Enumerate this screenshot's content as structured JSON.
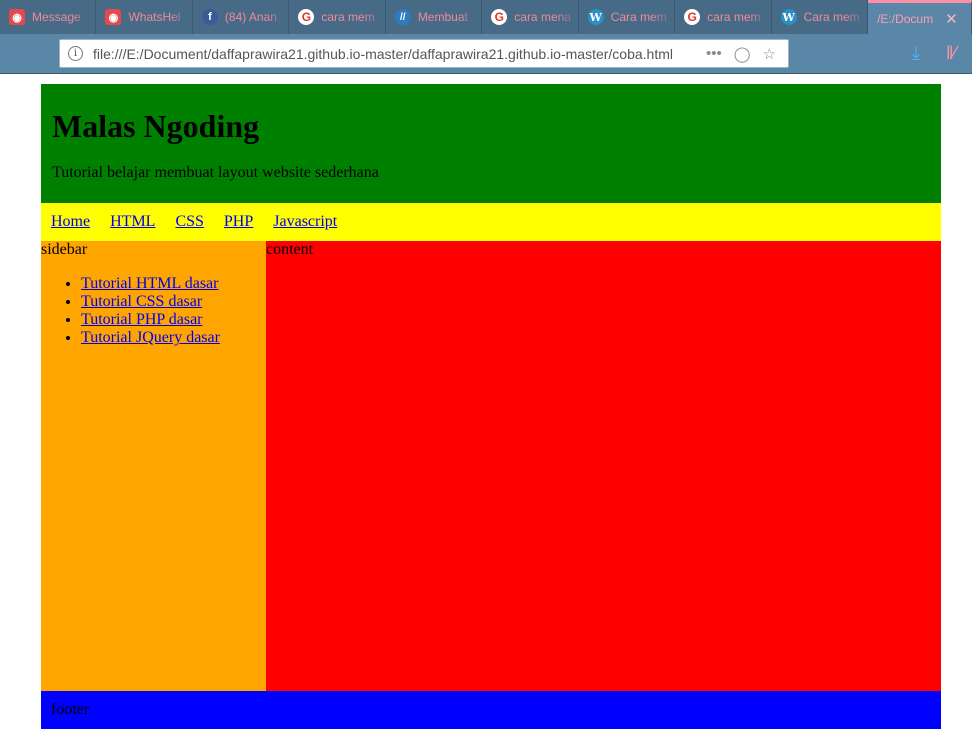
{
  "browser": {
    "tabs": [
      {
        "title": "Message",
        "icon": "red-chat-icon"
      },
      {
        "title": "WhatsHel",
        "icon": "red-chat-icon"
      },
      {
        "title": "(84) Anan",
        "icon": "facebook-icon"
      },
      {
        "title": "cara mem",
        "icon": "google-icon"
      },
      {
        "title": "Membuat",
        "icon": "code-icon"
      },
      {
        "title": "cara mena",
        "icon": "google-icon"
      },
      {
        "title": "Cara mem",
        "icon": "wordpress-icon"
      },
      {
        "title": "cara mem",
        "icon": "google-icon"
      },
      {
        "title": "Cara mem",
        "icon": "wordpress-icon"
      },
      {
        "title": "/E:/Docum",
        "icon": "none"
      }
    ],
    "url": "file:///E:/Document/daffaprawira21.github.io-master/daffaprawira21.github.io-master/coba.html"
  },
  "page": {
    "header": {
      "title": "Malas Ngoding",
      "tagline": "Tutorial belajar membuat layout website sederhana"
    },
    "menu": [
      "Home",
      "HTML",
      "CSS",
      "PHP",
      "Javascript"
    ],
    "sidebar": {
      "label": "sidebar",
      "links": [
        "Tutorial HTML dasar",
        "Tutorial CSS dasar",
        "Tutorial PHP dasar",
        "Tutorial JQuery dasar"
      ]
    },
    "content": {
      "label": "content"
    },
    "footer": {
      "label": "footer"
    },
    "colors": {
      "header": "#008000",
      "menu": "#ffff00",
      "sidebar": "#ffa500",
      "content": "#ff0000",
      "footer": "#0000ff"
    }
  }
}
